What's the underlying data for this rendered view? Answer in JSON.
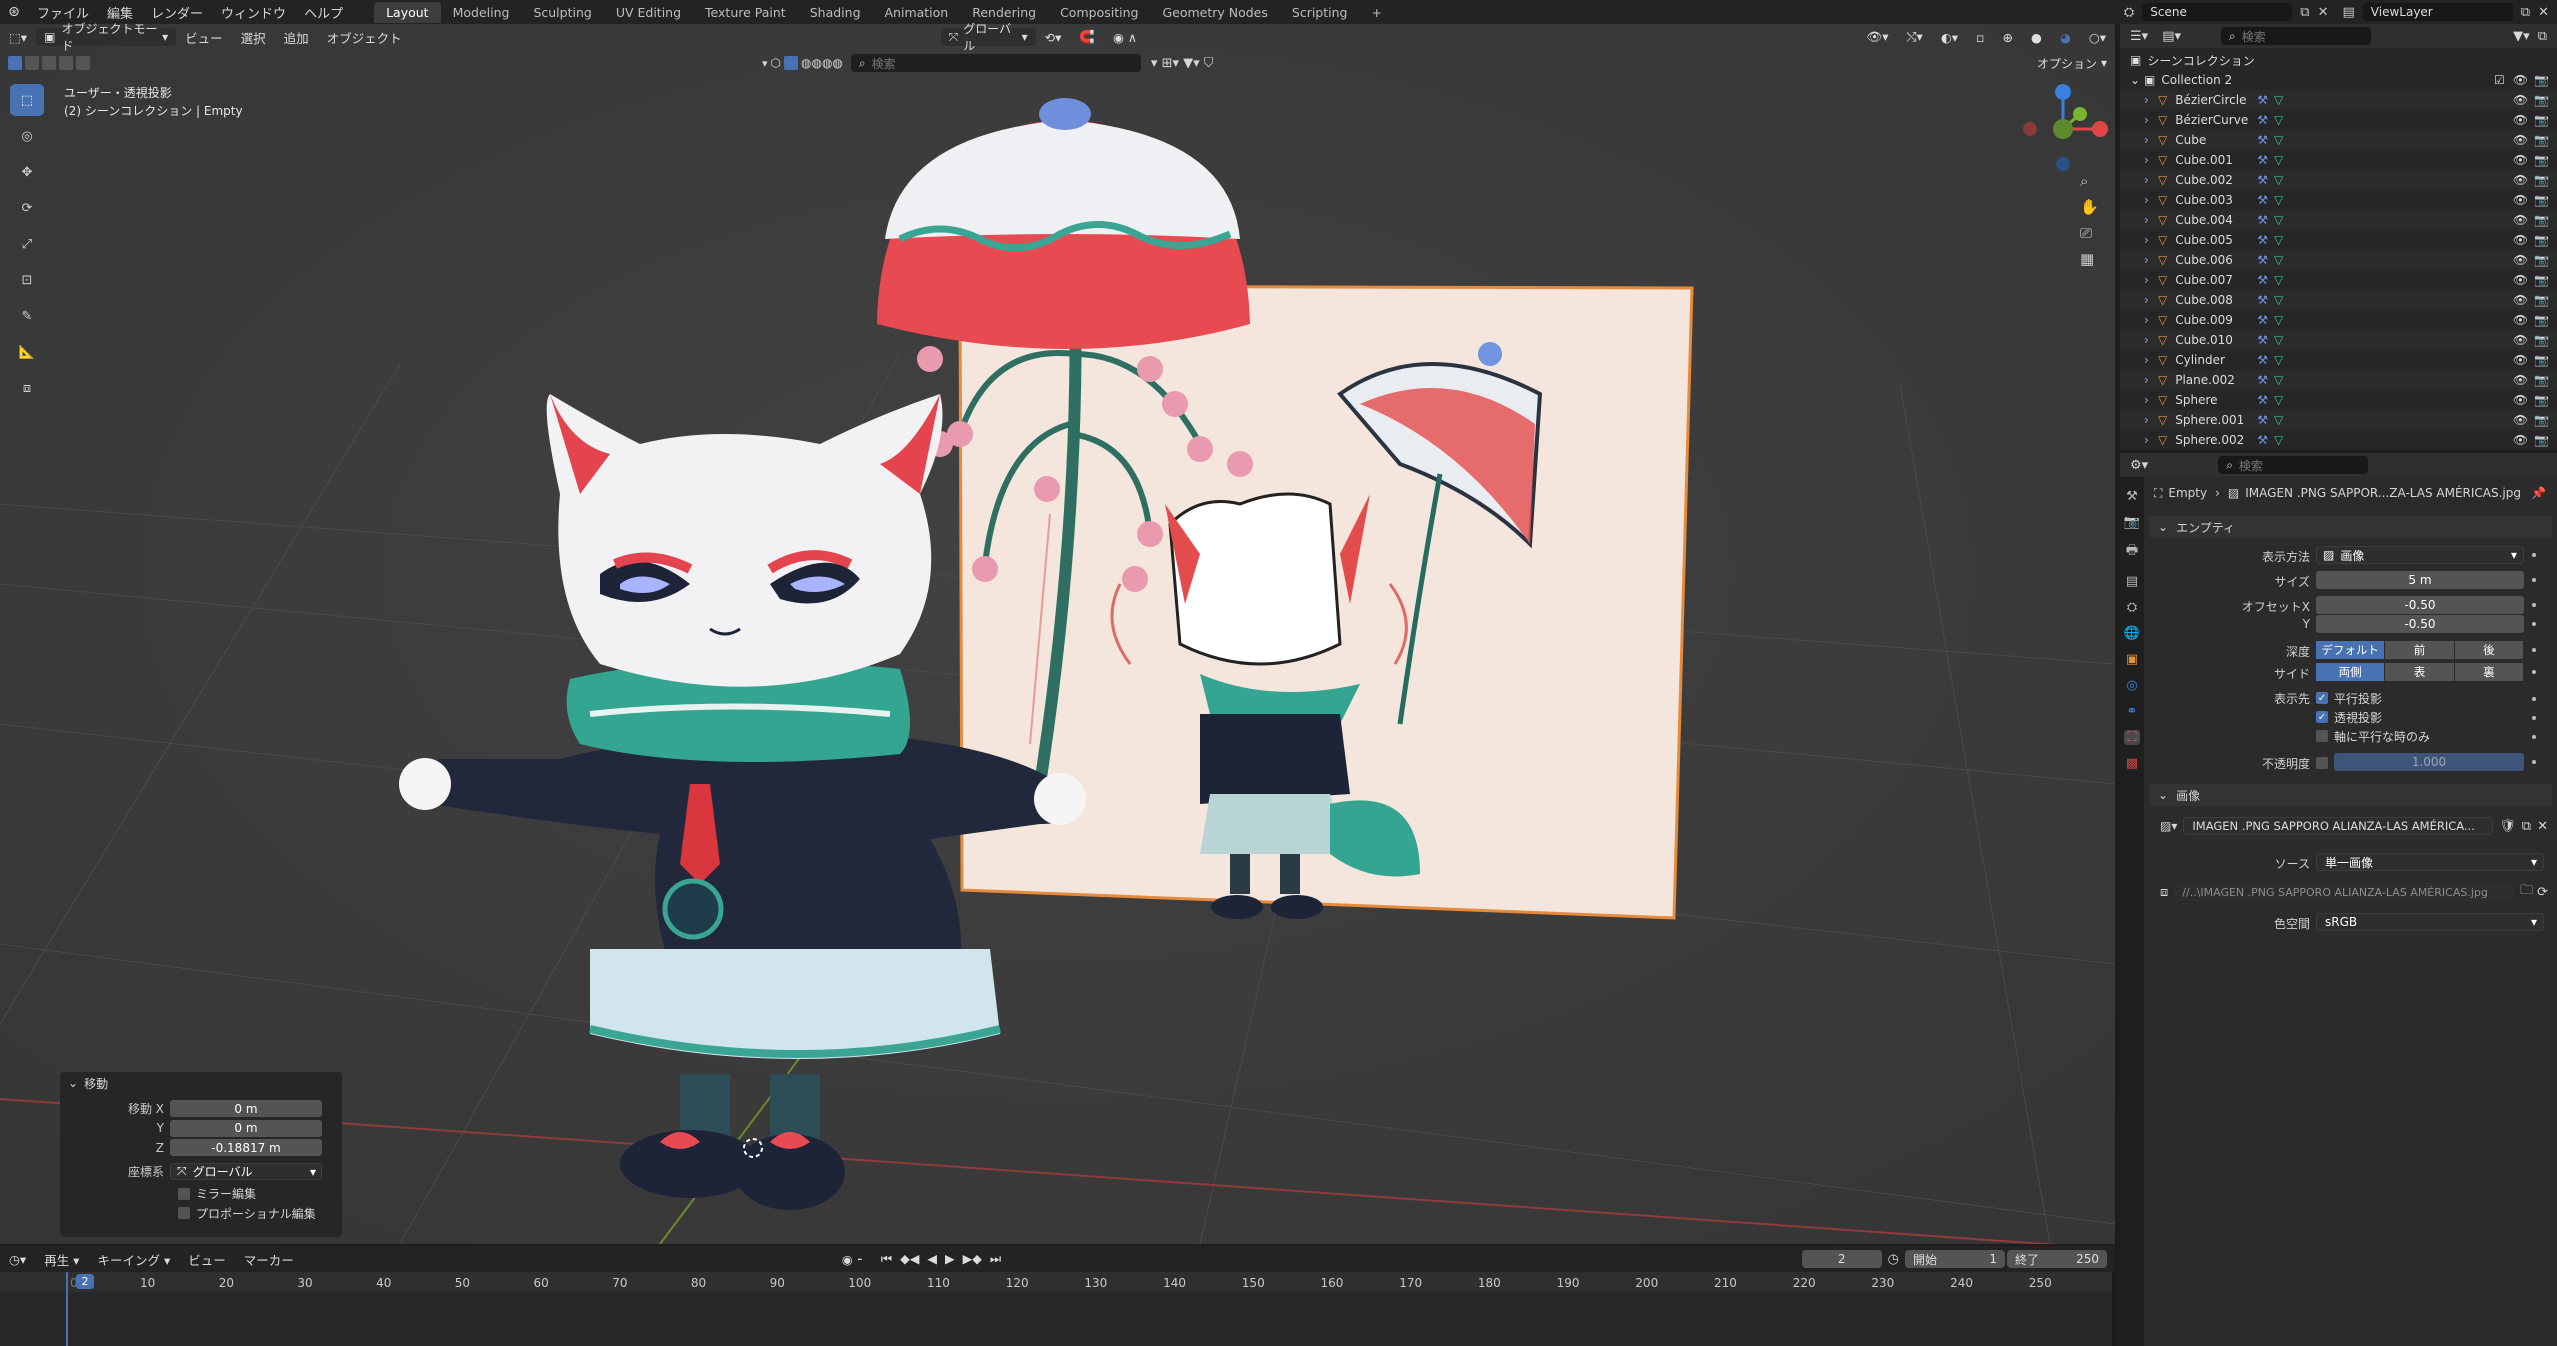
{
  "topbar": {
    "menus": [
      "ファイル",
      "編集",
      "レンダー",
      "ウィンドウ",
      "ヘルプ"
    ],
    "workspaces": [
      "Layout",
      "Modeling",
      "Sculpting",
      "UV Editing",
      "Texture Paint",
      "Shading",
      "Animation",
      "Rendering",
      "Compositing",
      "Geometry Nodes",
      "Scripting"
    ],
    "active_workspace": "Layout",
    "add_tab": "+",
    "scene": "Scene",
    "view_layer": "ViewLayer"
  },
  "viewport_header": {
    "mode": "オブジェクトモード",
    "menus": [
      "ビュー",
      "選択",
      "追加",
      "オブジェクト"
    ],
    "transform_orientation": "グローバル",
    "search_placeholder": "検索",
    "options": "オプション"
  },
  "viewport": {
    "view_name": "ユーザー・透視投影",
    "collection_info": "(2) シーンコレクション | Empty"
  },
  "redo_panel": {
    "title": "移動",
    "rows": [
      {
        "label": "移動 X",
        "value": "0 m"
      },
      {
        "label": "Y",
        "value": "0 m"
      },
      {
        "label": "Z",
        "value": "-0.18817 m"
      }
    ],
    "orientation_label": "座標系",
    "orientation_value": "グローバル",
    "mirror": "ミラー編集",
    "proportional": "プロポーショナル編集"
  },
  "timeline": {
    "playback": "再生",
    "keying": "キーイング",
    "view": "ビュー",
    "marker": "マーカー",
    "current_frame": "2",
    "start_label": "開始",
    "start": "1",
    "end_label": "終了",
    "end": "250",
    "frames": [
      "10",
      "20",
      "30",
      "40",
      "50",
      "60",
      "70",
      "80",
      "90",
      "100",
      "110",
      "120",
      "130",
      "140",
      "150",
      "160",
      "170",
      "180",
      "190",
      "200",
      "210",
      "220",
      "230",
      "240",
      "250"
    ],
    "cursor_label": "2"
  },
  "outliner": {
    "search_placeholder": "検索",
    "root": "シーンコレクション",
    "collection": "Collection 2",
    "objects": [
      "BézierCircle",
      "BézierCurve",
      "Cube",
      "Cube.001",
      "Cube.002",
      "Cube.003",
      "Cube.004",
      "Cube.005",
      "Cube.006",
      "Cube.007",
      "Cube.008",
      "Cube.009",
      "Cube.010",
      "Cylinder",
      "Plane.002",
      "Sphere",
      "Sphere.001",
      "Sphere.002"
    ]
  },
  "properties": {
    "search_placeholder": "検索",
    "breadcrumb_obj": "Empty",
    "breadcrumb_data": "IMAGEN .PNG SAPPOR...ZA-LAS AMÉRICAS.jpg",
    "empty_panel": "エンプティ",
    "display_as_label": "表示方法",
    "display_as": "画像",
    "size_label": "サイズ",
    "size": "5 m",
    "offset_x_label": "オフセットX",
    "offset_x": "-0.50",
    "offset_y_label": "Y",
    "offset_y": "-0.50",
    "depth_label": "深度",
    "depth_options": [
      "デフォルト",
      "前",
      "後"
    ],
    "side_label": "サイド",
    "side_options": [
      "両側",
      "表",
      "裏"
    ],
    "show_in_label": "表示先",
    "show_ortho": "平行投影",
    "show_persp": "透視投影",
    "show_axis_aligned": "軸に平行な時のみ",
    "opacity_label": "不透明度",
    "opacity": "1.000",
    "image_panel": "画像",
    "image_name": "IMAGEN .PNG SAPPORO ALIANZA-LAS AMÉRICA...",
    "source_label": "ソース",
    "source": "単一画像",
    "filepath": "//..\\IMAGEN .PNG SAPPORO ALIANZA-LAS AMÉRICAS.jpg",
    "colorspace_label": "色空間",
    "colorspace": "sRGB"
  },
  "colors": {
    "accent": "#4772b3",
    "panel": "#2b2b2b",
    "viewport_bg": "#3a3a3a",
    "header": "#232323"
  }
}
